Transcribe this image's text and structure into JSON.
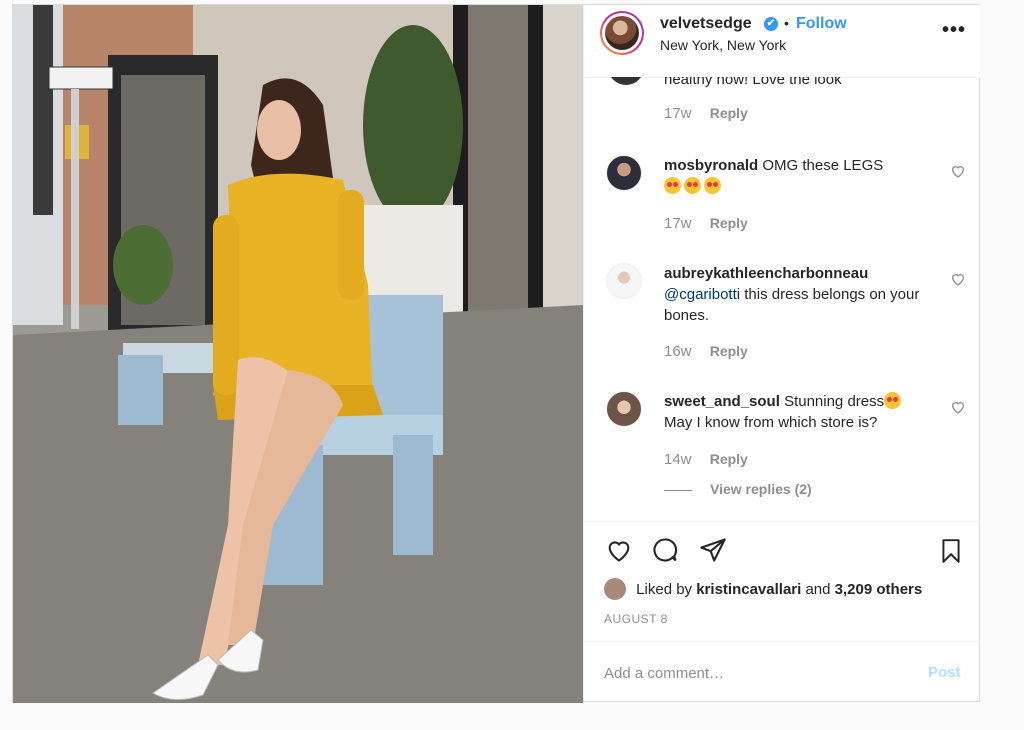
{
  "header": {
    "username": "velvetsedge",
    "verified_badge": "✔",
    "separator": "•",
    "follow_label": "Follow",
    "location": "New York, New York",
    "more_label": "•••"
  },
  "comments": {
    "cut_text": "healthy now! Love the look",
    "cut_time": "17w",
    "reply_label": "Reply",
    "items": [
      {
        "user": "mosbyronald",
        "text": "OMG these LEGS",
        "emoji_count": 3,
        "time": "17w"
      },
      {
        "user": "aubreykathleencharbonneau",
        "mention": "@cgaribotti",
        "text": "this dress belongs on your bones.",
        "time": "16w"
      },
      {
        "user": "sweet_and_soul",
        "text": "Stunning dress",
        "text2": "May I know from which store is?",
        "time": "14w"
      }
    ],
    "view_replies": "View replies (2)"
  },
  "actions": {
    "liked_prefix": "Liked by",
    "liked_user": "kristincavallari",
    "liked_and": "and",
    "liked_count": "3,209 others",
    "date": "AUGUST 8"
  },
  "add_comment": {
    "placeholder": "Add a comment…",
    "post_label": "Post"
  },
  "colors": {
    "accent": "#3897f0",
    "muted": "#8e8e8e",
    "dress": "#e8b324"
  }
}
